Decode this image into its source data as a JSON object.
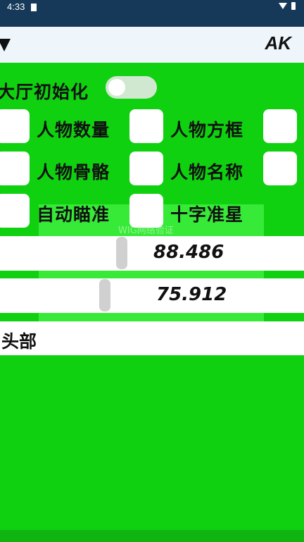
{
  "status_bar": {
    "time": "4:33"
  },
  "header": {
    "title": "AK"
  },
  "background_ghost": {
    "dialog_title": "WIG网络验证"
  },
  "lobby_init": {
    "label": "大厅初始化",
    "enabled": false
  },
  "checkboxes": [
    {
      "label": "人物数量",
      "checked": false
    },
    {
      "label": "人物方框",
      "checked": false
    },
    {
      "label": "人物骨骼",
      "checked": false
    },
    {
      "label": "人物名称",
      "checked": false
    },
    {
      "label": "自动瞄准",
      "checked": false
    },
    {
      "label": "十字准星",
      "checked": false
    }
  ],
  "sliders": [
    {
      "value": "88.486"
    },
    {
      "value": "75.912"
    }
  ],
  "target_select": {
    "selected": "头部"
  }
}
